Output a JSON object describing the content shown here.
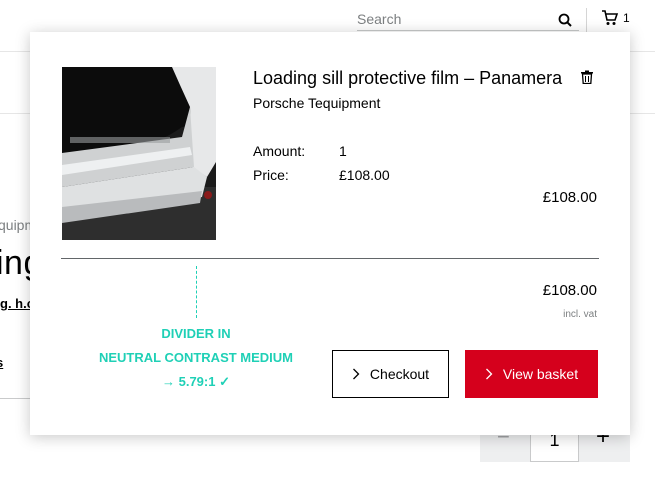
{
  "header": {
    "search_placeholder": "Search",
    "cart_count": "1"
  },
  "background": {
    "breadcrumb_fragment": "quipm",
    "title_fragment": "ing",
    "link_fragment": "g. h.c",
    "link2_fragment": "s",
    "stepper_minus": "−",
    "stepper_qty": "1",
    "stepper_plus": "+"
  },
  "flyout": {
    "product_name": "Loading sill protective film – Panamera",
    "brand": "Porsche Tequipment",
    "amount_label": "Amount:",
    "amount_value": "1",
    "price_label": "Price:",
    "price_value": "£108.00",
    "line_total": "£108.00",
    "subtotal": "£108.00",
    "vat_note": "incl. vat",
    "checkout_label": "Checkout",
    "view_basket_label": "View basket",
    "accent_color": "#d5001c"
  },
  "annotation": {
    "line1": "DIVIDER IN",
    "line2": "NEUTRAL CONTRAST MEDIUM",
    "line3": "→ 5.79:1 ✓",
    "color": "#1fd0b6"
  }
}
